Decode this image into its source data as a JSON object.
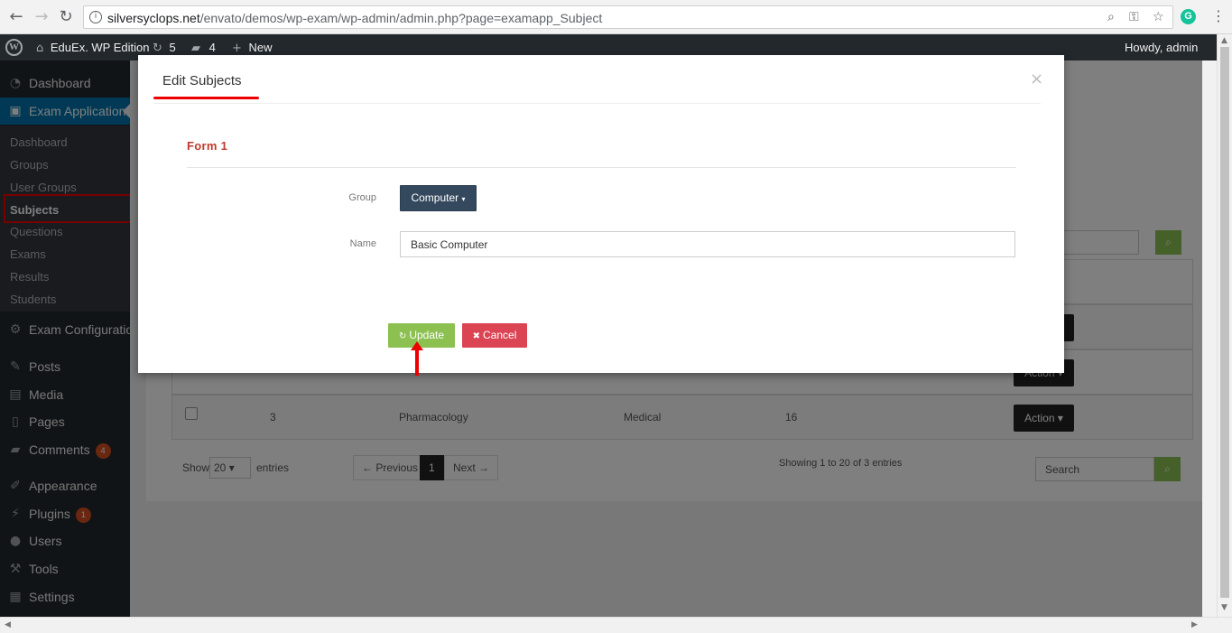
{
  "browser": {
    "back_icon": "←",
    "forward_icon": "→",
    "reload_icon": "↻",
    "info_icon": "i",
    "url_domain": "silversyclops.net",
    "url_path": "/envato/demos/wp-exam/wp-admin/admin.php?page=examapp_Subject",
    "zoom_icon": "⌕",
    "key_icon": "⚿",
    "star_icon": "☆",
    "grammarly_label": "G",
    "menu_icon": "⋮"
  },
  "adminbar": {
    "site_name": "EduEx. WP Edition",
    "updates_count": "5",
    "comments_count": "4",
    "new_label": "New",
    "howdy": "Howdy, admin"
  },
  "sidebar": {
    "dashboard": "Dashboard",
    "exam_application": "Exam Application",
    "submenu": [
      "Dashboard",
      "Groups",
      "User Groups",
      "Subjects",
      "Questions",
      "Exams",
      "Results",
      "Students"
    ],
    "exam_configuration": "Exam Configuration",
    "posts": "Posts",
    "media": "Media",
    "pages": "Pages",
    "comments": "Comments",
    "comments_badge": "4",
    "appearance": "Appearance",
    "plugins": "Plugins",
    "plugins_badge": "1",
    "users": "Users",
    "tools": "Tools",
    "settings": "Settings"
  },
  "table": {
    "search_placeholder_top": "Search",
    "action_label": "Action",
    "row": {
      "id": "3",
      "subject": "Pharmacology",
      "group": "Medical",
      "questions": "16"
    },
    "show_label": "Show",
    "show_value": "20",
    "entries_label": "entries",
    "prev_label": "← Previous",
    "page_label": "1",
    "next_label": "Next →",
    "showing_text": "Showing 1 to 20 of 3 entries",
    "search_placeholder_bottom": "Search"
  },
  "modal": {
    "title": "Edit Subjects",
    "close": "×",
    "form_title": "Form 1",
    "group_label": "Group",
    "group_value": "Computer",
    "name_label": "Name",
    "name_value": "Basic Computer",
    "update_label": "Update",
    "cancel_label": "Cancel"
  }
}
